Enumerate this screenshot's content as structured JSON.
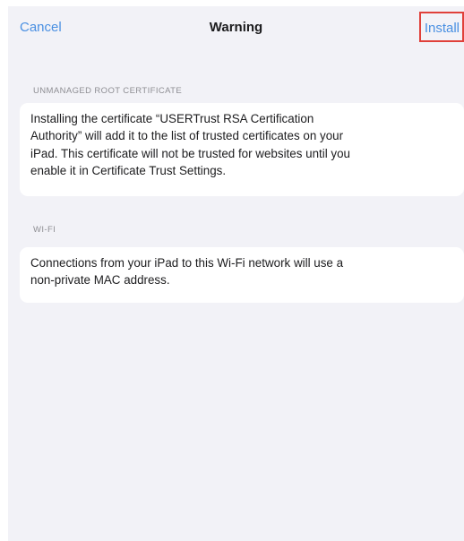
{
  "nav": {
    "cancel_label": "Cancel",
    "title": "Warning",
    "install_label": "Install",
    "accent_color": "#4a90e2",
    "highlight_color": "#e0403a"
  },
  "sections": [
    {
      "header": "UNMANAGED ROOT CERTIFICATE",
      "lines": [
        "Installing the certificate “USERTrust RSA Certification",
        "Authority” will add it to the list of trusted certificates on your",
        "iPad. This certificate will not be trusted for websites until you",
        "enable it in Certificate Trust Settings."
      ]
    },
    {
      "header": "WI-FI",
      "lines": [
        "Connections from your iPad to this Wi-Fi network will use a",
        "non-private MAC address."
      ]
    }
  ]
}
